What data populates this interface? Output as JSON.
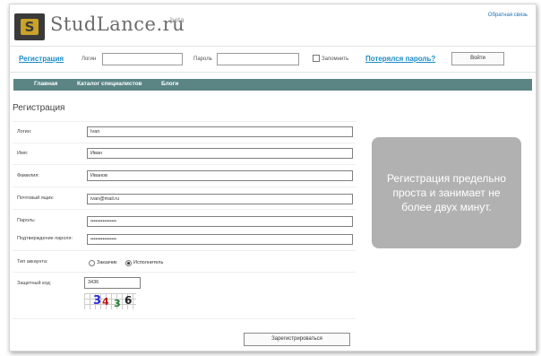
{
  "header": {
    "logo_mark": "S",
    "logo_text": "StudLance.ru",
    "beta": "beta",
    "feedback_link": "Обратная связь"
  },
  "login_bar": {
    "register_link": "Регистрация",
    "login_label": "Логин",
    "login_value": "",
    "password_label": "Пароль",
    "password_value": "",
    "remember_label": "Запомнить",
    "remember_checked": false,
    "forgot_link": "Потерялся пароль?",
    "login_button": "Войти"
  },
  "nav": {
    "items": [
      {
        "label": "Главная"
      },
      {
        "label": "Каталог специалистов"
      },
      {
        "label": "Блоги"
      }
    ]
  },
  "form": {
    "title": "Регистрация",
    "fields": [
      {
        "label": "Логин:",
        "value": "Ivan"
      },
      {
        "label": "Имя:",
        "value": "Иван"
      },
      {
        "label": "Фамилия:",
        "value": "Иванов"
      },
      {
        "label": "Почтовый ящик:",
        "value": "ivan@mail.ru"
      },
      {
        "label": "Пароль:",
        "value": "•••••••••••••••"
      },
      {
        "label": "Подтверждение пароля:",
        "value": "•••••••••••••••"
      }
    ],
    "account_type_label": "Тип аккаунта:",
    "account_types": [
      {
        "label": "Заказчик",
        "selected": false
      },
      {
        "label": "Исполнитель",
        "selected": true
      }
    ],
    "captcha_label": "Защитный код:",
    "captcha_value": "3436",
    "captcha_glyphs": [
      "3",
      "4",
      "3",
      "6"
    ],
    "submit_button": "Зарегистрироваться"
  },
  "info_box": {
    "text": "Регистрация предельно проста и занимает не более двух минут."
  },
  "colors": {
    "nav_bg": "#5a8584",
    "link": "#1a8cc8",
    "info_bg": "#b1b1b1"
  }
}
